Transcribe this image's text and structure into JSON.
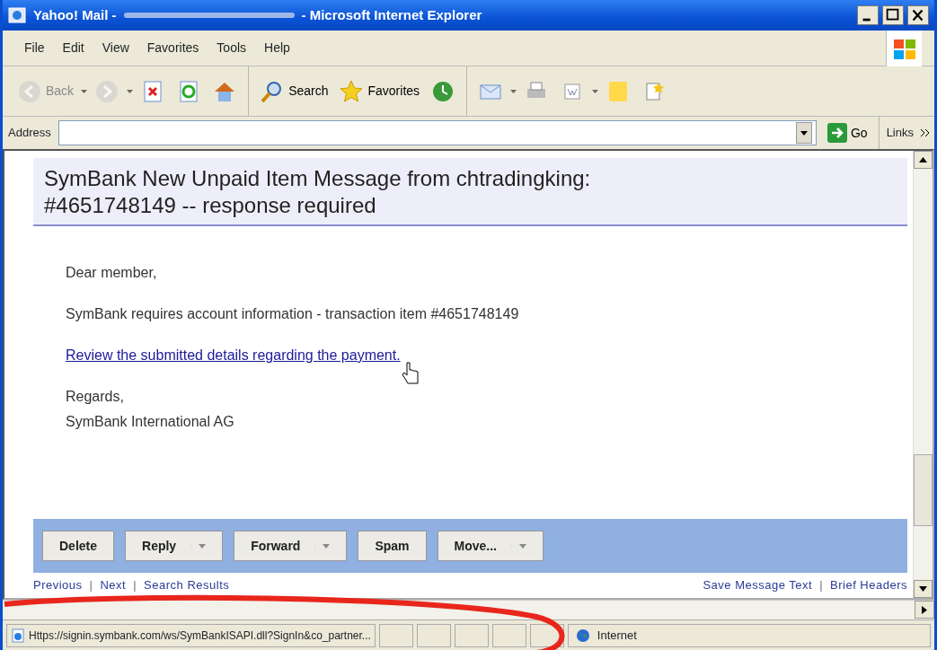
{
  "window": {
    "title_left": "Yahoo! Mail -",
    "title_right": "- Microsoft Internet Explorer"
  },
  "menu": [
    "File",
    "Edit",
    "View",
    "Favorites",
    "Tools",
    "Help"
  ],
  "toolbar": [
    {
      "kind": "back",
      "label": "Back",
      "disabled": true
    },
    {
      "kind": "forward",
      "disabled": true
    },
    {
      "kind": "stop"
    },
    {
      "kind": "refresh"
    },
    {
      "kind": "home"
    },
    {
      "kind": "search",
      "label": "Search"
    },
    {
      "kind": "favorites",
      "label": "Favorites"
    },
    {
      "kind": "history"
    },
    {
      "kind": "mail"
    },
    {
      "kind": "print"
    },
    {
      "kind": "edit"
    },
    {
      "kind": "notes"
    },
    {
      "kind": "messenger"
    }
  ],
  "address": {
    "label": "Address",
    "go": "Go",
    "links": "Links"
  },
  "email": {
    "subject": "SymBank New Unpaid Item Message from chtradingking: #4651748149 -- response required",
    "greeting": "Dear member,",
    "body": "SymBank requires account information - transaction item #4651748149",
    "link": "Review the submitted details regarding the payment.",
    "closing": "Regards,",
    "signature": "SymBank International AG"
  },
  "actions": [
    {
      "label": "Delete",
      "dropdown": false
    },
    {
      "label": "Reply",
      "dropdown": true
    },
    {
      "label": "Forward",
      "dropdown": true
    },
    {
      "label": "Spam",
      "dropdown": false
    },
    {
      "label": "Move...",
      "dropdown": true
    }
  ],
  "nav_separator": "|",
  "nav_left": [
    "Previous",
    "Next",
    "Search Results"
  ],
  "nav_right": [
    "Save Message Text",
    "Brief Headers"
  ],
  "status_bar": {
    "url": "Https://signin.symbank.com/ws/SymBankISAPI.dll?SignIn&co_partner...",
    "zone": "Internet"
  }
}
